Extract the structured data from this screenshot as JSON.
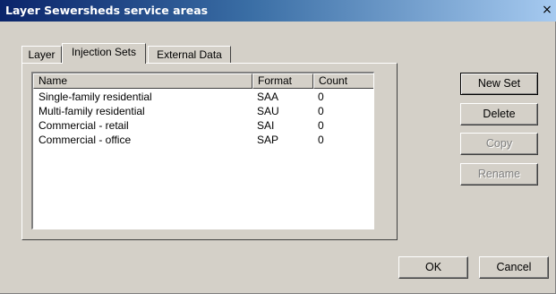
{
  "window": {
    "title": "Layer Sewersheds service areas",
    "close_label": "×"
  },
  "tabs": [
    {
      "label": "Layer",
      "active": false
    },
    {
      "label": "Injection Sets",
      "active": true
    },
    {
      "label": "External Data",
      "active": false
    }
  ],
  "list": {
    "columns": [
      "Name",
      "Format",
      "Count"
    ],
    "rows": [
      {
        "name": "Single-family residential",
        "format": "SAA",
        "count": "0"
      },
      {
        "name": "Multi-family residential",
        "format": "SAU",
        "count": "0"
      },
      {
        "name": "Commercial - retail",
        "format": "SAI",
        "count": "0"
      },
      {
        "name": "Commercial - office",
        "format": "SAP",
        "count": "0"
      }
    ]
  },
  "buttons": {
    "new_set": "New Set",
    "delete": "Delete",
    "copy": "Copy",
    "rename": "Rename",
    "ok": "OK",
    "cancel": "Cancel"
  },
  "colors": {
    "title_bar_start": "#0a246a",
    "title_bar_end": "#a6caf0",
    "dialog_face": "#d4d0c8",
    "disabled_text": "#808080"
  }
}
